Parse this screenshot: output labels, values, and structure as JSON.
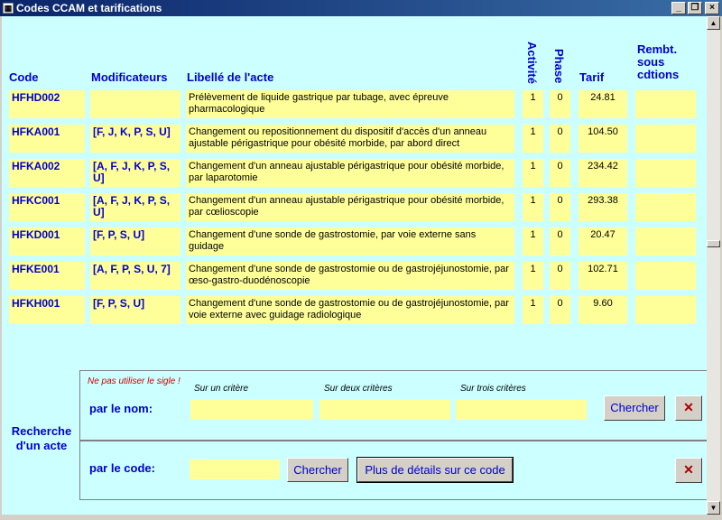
{
  "window": {
    "title": "Codes CCAM et tarifications",
    "icon": "form-icon"
  },
  "headers": {
    "code": "Code",
    "modificateurs": "Modificateurs",
    "libelle": "Libellé de l'acte",
    "activite": "Activité",
    "phase": "Phase",
    "tarif": "Tarif",
    "rembt": "Rembt. sous cdtions"
  },
  "rows": [
    {
      "code": "HFHD002",
      "mod": "",
      "libelle": "Prélèvement de liquide gastrique par tubage, avec épreuve pharmacologique",
      "activite": "1",
      "phase": "0",
      "tarif": "24.81",
      "rembt": ""
    },
    {
      "code": "HFKA001",
      "mod": "[F, J, K, P, S, U]",
      "libelle": "Changement ou repositionnement du dispositif d'accès d'un anneau ajustable périgastrique pour obésité morbide, par abord direct",
      "activite": "1",
      "phase": "0",
      "tarif": "104.50",
      "rembt": ""
    },
    {
      "code": "HFKA002",
      "mod": "[A, F, J, K, P, S, U]",
      "libelle": "Changement d'un anneau ajustable périgastrique pour obésité morbide, par laparotomie",
      "activite": "1",
      "phase": "0",
      "tarif": "234.42",
      "rembt": ""
    },
    {
      "code": "HFKC001",
      "mod": "[A, F, J, K, P, S, U]",
      "libelle": "Changement d'un anneau ajustable périgastrique pour obésité morbide, par cœlioscopie",
      "activite": "1",
      "phase": "0",
      "tarif": "293.38",
      "rembt": ""
    },
    {
      "code": "HFKD001",
      "mod": "[F, P, S, U]",
      "libelle": "Changement d'une sonde de gastrostomie, par voie externe sans guidage",
      "activite": "1",
      "phase": "0",
      "tarif": "20.47",
      "rembt": ""
    },
    {
      "code": "HFKE001",
      "mod": "[A, F, P, S, U, 7]",
      "libelle": "Changement d'une sonde de gastrostomie ou de gastrojéjunostomie, par œso-gastro-duodénoscopie",
      "activite": "1",
      "phase": "0",
      "tarif": "102.71",
      "rembt": ""
    },
    {
      "code": "HFKH001",
      "mod": "[F, P, S, U]",
      "libelle": "Changement d'une sonde de gastrostomie ou de gastrojéjunostomie, par voie externe avec guidage radiologique",
      "activite": "1",
      "phase": "0",
      "tarif": "9.60",
      "rembt": ""
    }
  ],
  "search": {
    "title": "Recherche d'un acte",
    "warning": "Ne pas utiliser le sigle !",
    "criteria": [
      "Sur un critère",
      "Sur deux critères",
      "Sur trois critères"
    ],
    "by_name_label": "par le nom:",
    "by_code_label": "par le code:",
    "search_button": "Chercher",
    "details_button": "Plus de détails sur ce code",
    "clear_icon": "clear-filter-icon"
  }
}
